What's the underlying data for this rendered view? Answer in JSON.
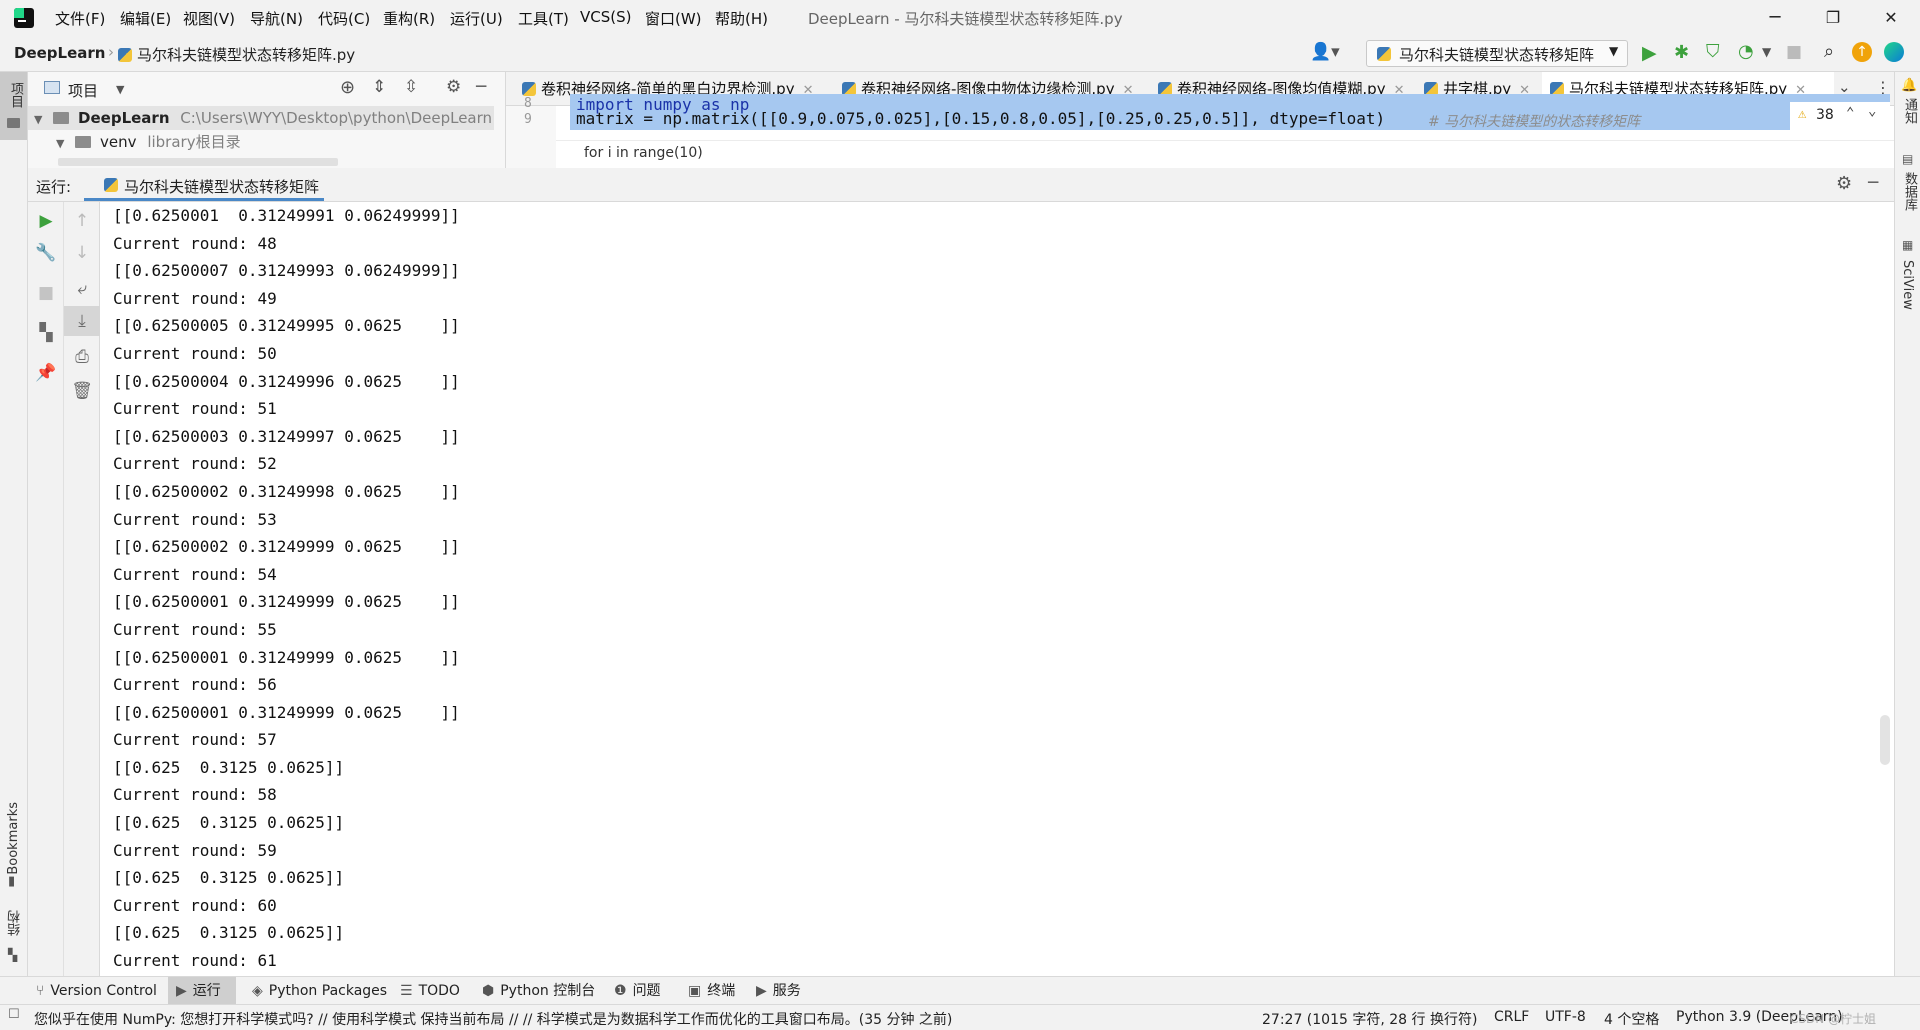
{
  "titlebar": {
    "menu": [
      "文件(F)",
      "编辑(E)",
      "视图(V)",
      "导航(N)",
      "代码(C)",
      "重构(R)",
      "运行(U)",
      "工具(T)",
      "VCS(S)",
      "窗口(W)",
      "帮助(H)"
    ],
    "title": "DeepLearn - 马尔科夫链模型状态转移矩阵.py",
    "minimize": "─",
    "restore": "❐",
    "close": "✕"
  },
  "navbar": {
    "breadcrumb_project": "DeepLearn",
    "breadcrumb_file": "马尔科夫链模型状态转移矩阵.py",
    "run_config": "马尔科夫链模型状态转移矩阵"
  },
  "left_strip": {
    "project_label": "项目",
    "bookmarks_label": "Bookmarks",
    "structure_label": "结构"
  },
  "right_strip": {
    "notifications_label": "通知",
    "database_label": "数据库",
    "sciview_label": "SciView"
  },
  "project_panel": {
    "title": "项目",
    "root_name": "DeepLearn",
    "root_path": "C:\\Users\\WYY\\Desktop\\python\\DeepLearn",
    "venv_name": "venv",
    "venv_note": "library根目录"
  },
  "editor": {
    "tabs": [
      {
        "label": "卷积神经网络-简单的黑白边界检测.py",
        "active": false
      },
      {
        "label": "卷积神经网络-图像中物体边缘检测.py",
        "active": false
      },
      {
        "label": "卷积神经网络-图像均值模糊.py",
        "active": false
      },
      {
        "label": "井字棋.py",
        "active": false
      },
      {
        "label": "马尔科夫链模型状态转移矩阵.py",
        "active": true
      }
    ],
    "line8_number": "8",
    "line8_code": "import numpy as np",
    "line9_number": "9",
    "line9_code": "matrix = np.matrix([[0.9,0.075,0.025],[0.15,0.8,0.05],[0.25,0.25,0.5]], dtype=float)",
    "line9_comment": "# 马尔科夫链模型的状态转移矩阵",
    "breadcrumb": "for i in range(10)",
    "warning_count": "38"
  },
  "run_panel": {
    "label": "运行:",
    "tab_name": "马尔科夫链模型状态转移矩阵"
  },
  "console_lines": [
    "[[0.6250001  0.31249991 0.06249999]]",
    "Current round: 48",
    "[[0.62500007 0.31249993 0.06249999]]",
    "Current round: 49",
    "[[0.62500005 0.31249995 0.0625    ]]",
    "Current round: 50",
    "[[0.62500004 0.31249996 0.0625    ]]",
    "Current round: 51",
    "[[0.62500003 0.31249997 0.0625    ]]",
    "Current round: 52",
    "[[0.62500002 0.31249998 0.0625    ]]",
    "Current round: 53",
    "[[0.62500002 0.31249999 0.0625    ]]",
    "Current round: 54",
    "[[0.62500001 0.31249999 0.0625    ]]",
    "Current round: 55",
    "[[0.62500001 0.31249999 0.0625    ]]",
    "Current round: 56",
    "[[0.62500001 0.31249999 0.0625    ]]",
    "Current round: 57",
    "[[0.625  0.3125 0.0625]]",
    "Current round: 58",
    "[[0.625  0.3125 0.0625]]",
    "Current round: 59",
    "[[0.625  0.3125 0.0625]]",
    "Current round: 60",
    "[[0.625  0.3125 0.0625]]",
    "Current round: 61"
  ],
  "bottom_tabs": [
    {
      "label": "Version Control",
      "active": false
    },
    {
      "label": "运行",
      "active": true
    },
    {
      "label": "Python Packages",
      "active": false
    },
    {
      "label": "TODO",
      "active": false
    },
    {
      "label": "Python 控制台",
      "active": false
    },
    {
      "label": "问题",
      "active": false
    },
    {
      "label": "终端",
      "active": false
    },
    {
      "label": "服务",
      "active": false
    }
  ],
  "status_bar": {
    "message": "您似乎在使用 NumPy: 您想打开科学模式吗? // 使用科学模式   保持当前布局 // // 科学模式是为数据科学工作而优化的工具窗口布局。(35 分钟 之前)",
    "position": "27:27 (1015 字符, 28 行 换行符)",
    "line_sep": "CRLF",
    "encoding": "UTF-8",
    "indent": "4 个空格",
    "interpreter": "Python 3.9 (DeepLearn)",
    "watermark": "CSDN @柠士姐"
  },
  "colors": {
    "accent": "#4a88c7",
    "run_green": "#3da13d",
    "selection": "#a6c8f0",
    "keyword": "#1a32a8",
    "number": "#1750eb",
    "comment": "#8c8c8c"
  }
}
